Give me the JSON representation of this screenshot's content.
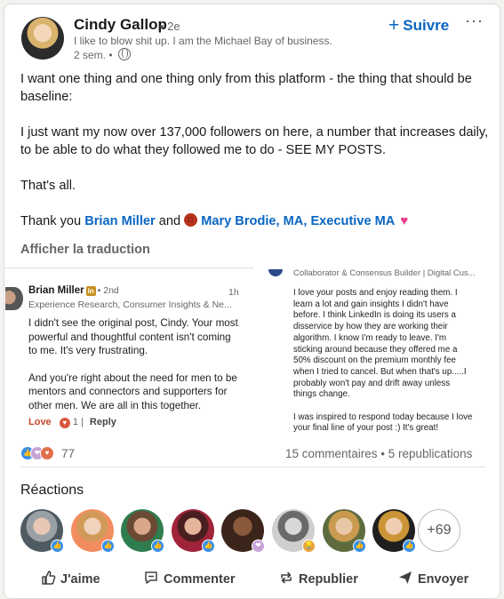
{
  "post": {
    "author_name": "Cindy Gallop",
    "degree": "• 2e",
    "headline": "I like to blow shit up. I am the Michael Bay of business.",
    "time": "2 sem. •",
    "follow_label": "Suivre",
    "more_label": "···",
    "paragraph1": "I want one thing and one thing only from this platform - the thing that should be baseline:",
    "paragraph2": "I just want my now over 137,000 followers on here, a number that increases daily, to be able to do what they followed me to do - SEE MY POSTS.",
    "paragraph3": "That's all.",
    "thanks_prefix": "Thank you",
    "mention1": "Brian Miller",
    "and_word": "and",
    "mention2": "Mary Brodie, MA, Executive MA",
    "translate_label": "Afficher la traduction"
  },
  "embedded_comment": {
    "name": "Brian Miller",
    "in_label": "in",
    "degree": "• 2nd",
    "time": "1h",
    "headline": "Experience Research, Consumer Insights & Ne...",
    "lines": [
      "I didn't see the original post, Cindy. Your most",
      "powerful and thoughtful content isn't coming",
      "to me. It's very frustrating."
    ],
    "lines2": [
      "And you're right about the need for men to be",
      "mentors and connectors and supporters for",
      "other men. We are all in this together."
    ],
    "love_label": "Love",
    "reaction_count": "1",
    "reply_label": "Reply"
  },
  "embedded_reply": {
    "headline": "Collaborator & Consensus Builder | Digital Cus...",
    "lines": [
      "I love your posts and enjoy reading them. I",
      "learn a lot and gain insights I didn't have",
      "before. I think LinkedIn is doing its users a",
      "disservice by how they are working their",
      "algorithm. I know I'm ready to leave. I'm",
      "sticking around because they offered me a",
      "50% discount on the premium monthly fee",
      "when I tried to cancel. But when that's up.....I",
      "probably won't pay and drift away unless",
      "things change."
    ],
    "lines2": [
      "I was inspired to respond today because I love",
      "your final line of your post :) It's great!"
    ]
  },
  "stats": {
    "reaction_count": "77",
    "comments_reposts": "15 commentaires • 5 republications"
  },
  "reactions": {
    "title": "Réactions",
    "more_count": "+69"
  },
  "actions": {
    "like": "J'aime",
    "comment": "Commenter",
    "repost": "Republier",
    "send": "Envoyer"
  },
  "colors": {
    "link": "#0a66c2",
    "like": "#378fe9",
    "love": "#df704d"
  }
}
